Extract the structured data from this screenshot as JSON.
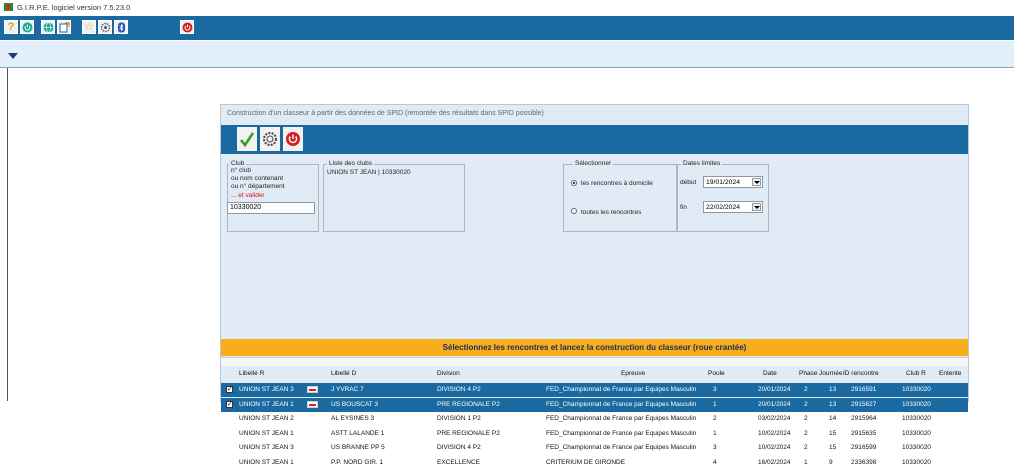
{
  "app": {
    "title": "G.I.R.P.E.  logiciel version  7.5.23.0"
  },
  "toolbar": {
    "icons": [
      "help-icon",
      "power-green-icon",
      "globe-icon",
      "export-icon",
      "star-icon",
      "settings-icon",
      "bluetooth-icon",
      "power-red-icon"
    ]
  },
  "dialog": {
    "title": "Construction d'un classeur à partir des données de SPID (remontée des résultats dans SPID possible)",
    "club_group": {
      "label": "Club",
      "lines": [
        "n° club",
        "ou nom contenant",
        "ou n° département"
      ],
      "validate_hint": "... et valider",
      "value": "10330020"
    },
    "clubs_list": {
      "label": "Liste des clubs",
      "items": [
        "UNION ST JEAN | 10330020"
      ]
    },
    "select_group": {
      "label": "Sélectionner",
      "option_home": "les rencontres à domicile",
      "option_all": "toutes les rencontres",
      "selected": "home"
    },
    "dates_group": {
      "label": "Dates limites",
      "start_label": "début",
      "start_value": "19/01/2024",
      "end_label": "fin",
      "end_value": "22/02/2024"
    },
    "banner": "Sélectionnez les rencontres et lancez la construction du classeur (roue crantée)",
    "table": {
      "headers": [
        "Libellé R",
        "Libellé D",
        "Division",
        "Epreuve",
        "Poule",
        "Date",
        "Phase",
        "Journée",
        "ID rencontre",
        "Club R",
        "Entente"
      ],
      "rows": [
        {
          "selected": true,
          "flag": true,
          "libR": "UNION ST JEAN 3",
          "libD": "J YVRAC 7",
          "division": "DIVISION 4 P2",
          "epreuve": "FED_Championnat de France par Equipes Masculin",
          "poule": "3",
          "date": "20/01/2024",
          "phase": "2",
          "journee": "13",
          "id": "2916591",
          "club": "10330020"
        },
        {
          "selected": true,
          "flag": true,
          "libR": "UNION ST JEAN 1",
          "libD": "US BOUSCAT 3",
          "division": "PRE REGIONALE P2",
          "epreuve": "FED_Championnat de France par Equipes Masculin",
          "poule": "1",
          "date": "20/01/2024",
          "phase": "2",
          "journee": "13",
          "id": "2915627",
          "club": "10330020"
        },
        {
          "selected": false,
          "flag": false,
          "libR": "UNION ST JEAN 2",
          "libD": "AL EYSINES 3",
          "division": "DIVISION 1 P2",
          "epreuve": "FED_Championnat de France par Equipes Masculin",
          "poule": "2",
          "date": "03/02/2024",
          "phase": "2",
          "journee": "14",
          "id": "2915964",
          "club": "10330020"
        },
        {
          "selected": false,
          "flag": false,
          "libR": "UNION ST JEAN 1",
          "libD": "ASTT LALANDE 1",
          "division": "PRE REGIONALE P2",
          "epreuve": "FED_Championnat de France par Equipes Masculin",
          "poule": "1",
          "date": "10/02/2024",
          "phase": "2",
          "journee": "15",
          "id": "2915635",
          "club": "10330020"
        },
        {
          "selected": false,
          "flag": false,
          "libR": "UNION ST JEAN 3",
          "libD": "US BRANNE PP 5",
          "division": "DIVISION 4 P2",
          "epreuve": "FED_Championnat de France par Equipes Masculin",
          "poule": "3",
          "date": "10/02/2024",
          "phase": "2",
          "journee": "15",
          "id": "2916599",
          "club": "10330020"
        },
        {
          "selected": false,
          "flag": false,
          "libR": "UNION ST JEAN 1",
          "libD": "P.P. NORD GIR. 1",
          "division": "EXCELLENCE",
          "epreuve": "CRITERIUM DE GIRONDE",
          "poule": "4",
          "date": "16/02/2024",
          "phase": "1",
          "journee": "9",
          "id": "2336398",
          "club": "10330020"
        }
      ]
    }
  }
}
